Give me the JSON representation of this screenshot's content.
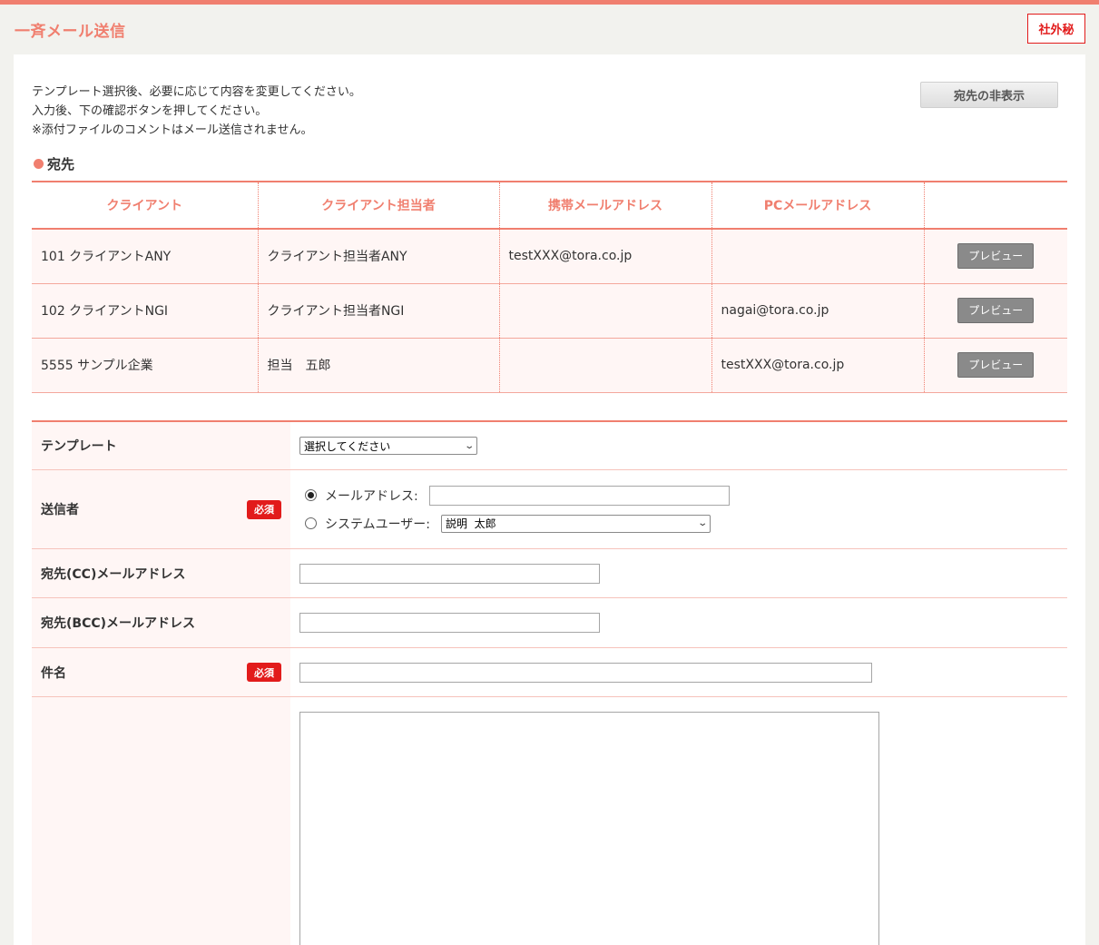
{
  "header": {
    "title": "一斉メール送信",
    "confidential_badge": "社外秘"
  },
  "intro": {
    "line1": "テンプレート選択後、必要に応じて内容を変更してください。",
    "line2": "入力後、下の確認ボタンを押してください。",
    "line3": "※添付ファイルのコメントはメール送信されません。"
  },
  "toggle_button": "宛先の非表示",
  "recipients": {
    "heading": "宛先",
    "columns": [
      "クライアント",
      "クライアント担当者",
      "携帯メールアドレス",
      "PCメールアドレス",
      ""
    ],
    "rows": [
      {
        "client": "101 クライアントANY",
        "contact": "クライアント担当者ANY",
        "mobile": "testXXX@tora.co.jp",
        "pc": "",
        "action": "プレビュー"
      },
      {
        "client": "102 クライアントNGI",
        "contact": "クライアント担当者NGI",
        "mobile": "",
        "pc": "nagai@tora.co.jp",
        "action": "プレビュー"
      },
      {
        "client": "5555 サンプル企業",
        "contact": "担当　五郎",
        "mobile": "",
        "pc": "testXXX@tora.co.jp",
        "action": "プレビュー"
      }
    ]
  },
  "form": {
    "template": {
      "label": "テンプレート",
      "selected": "選択してください"
    },
    "sender": {
      "label": "送信者",
      "required": "必須",
      "option_email": "メールアドレス:",
      "option_system": "システムユーザー:",
      "system_user_selected": "説明  太郎",
      "selected_option": "email"
    },
    "cc": {
      "label": "宛先(CC)メールアドレス",
      "value": ""
    },
    "bcc": {
      "label": "宛先(BCC)メールアドレス",
      "value": ""
    },
    "subject": {
      "label": "件名",
      "required": "必須",
      "value": ""
    },
    "body": {
      "value": ""
    }
  },
  "colors": {
    "accent": "#f07f6f",
    "required": "#e21b1b",
    "row_bg": "#fff6f5"
  },
  "icons": [
    "bullet-dot-icon",
    "radio-selected-icon",
    "radio-unselected-icon",
    "chevron-down-icon"
  ]
}
